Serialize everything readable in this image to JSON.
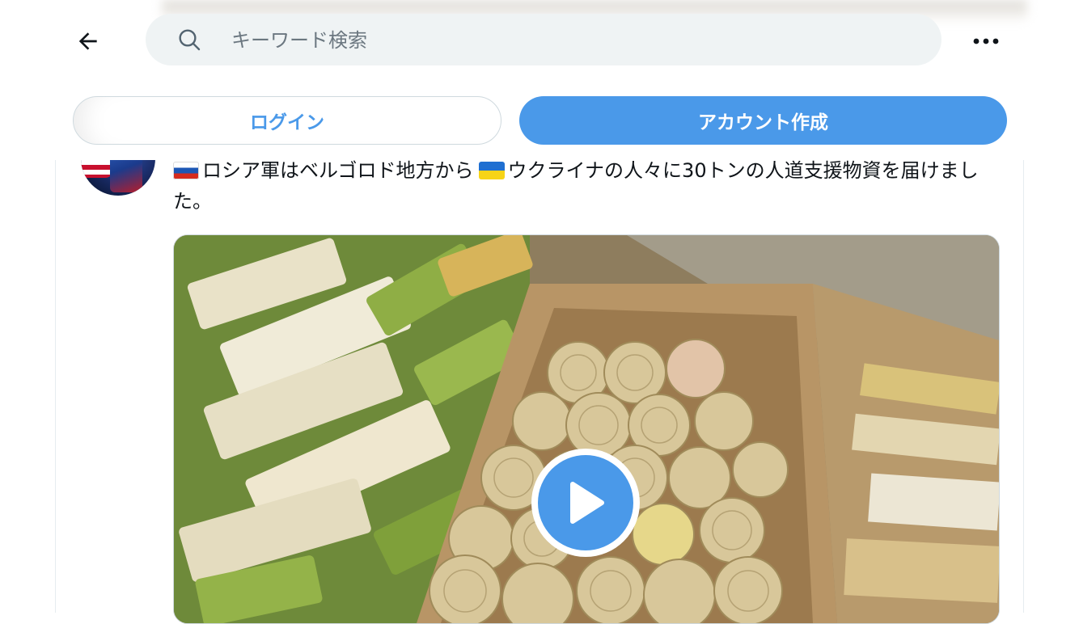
{
  "search": {
    "placeholder": "キーワード検索"
  },
  "icons": {
    "back": "arrow-left-icon",
    "search": "search-icon",
    "more": "more-horizontal-icon",
    "play": "play-icon"
  },
  "auth": {
    "login_label": "ログイン",
    "signup_label": "アカウント作成"
  },
  "tweet": {
    "text_part1": "ロシア軍はベルゴロド地方から",
    "text_part2": "ウクライナの人々に30トンの人道支援物資を届けました。",
    "flag_1": "russia-flag",
    "flag_2": "ukraine-flag"
  },
  "colors": {
    "accent": "#4a99e9",
    "search_bg": "#eff3f4",
    "text": "#0f1419",
    "border": "#cfd9de"
  }
}
